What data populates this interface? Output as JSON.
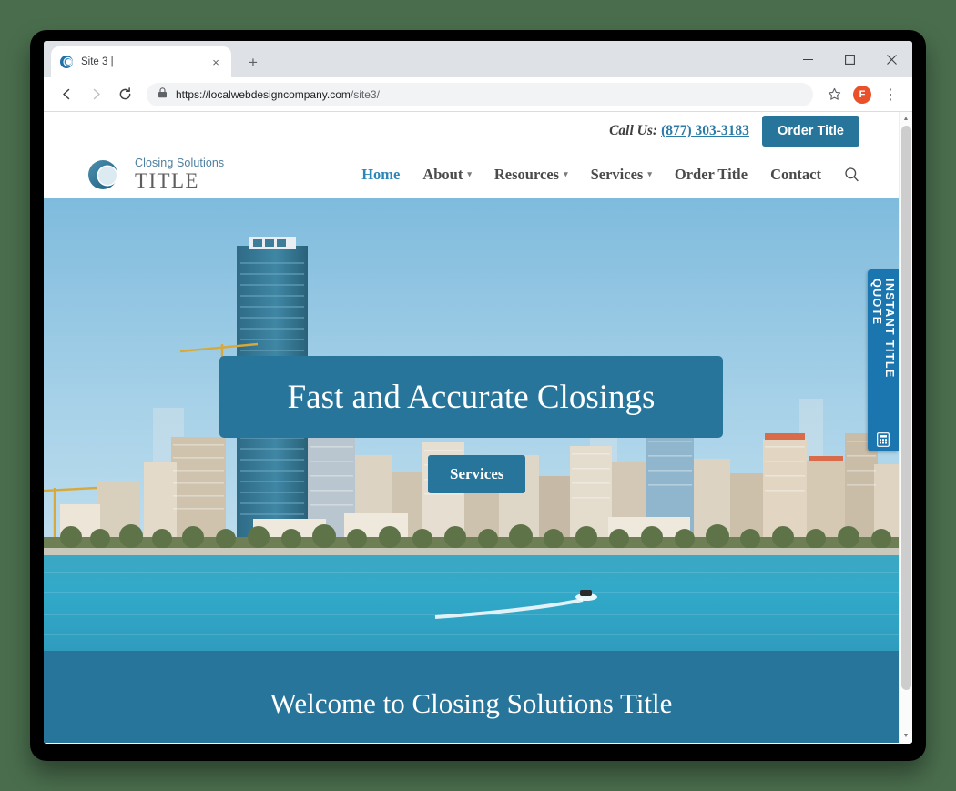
{
  "browser": {
    "tab": {
      "title": "Site 3 |",
      "favicon": "site-circle-icon",
      "close": "×"
    },
    "new_tab": "+",
    "window_controls": {
      "minimize": "–",
      "maximize": "□",
      "close": "×"
    },
    "toolbar": {
      "back": "←",
      "forward": "→",
      "reload": "⟳",
      "lock_icon": "lock-icon",
      "url_domain": "https://localwebdesigncompany.com",
      "url_path": "/site3/",
      "bookmark": "☆",
      "profile_initial": "F",
      "menu": "⋮"
    }
  },
  "site": {
    "topbar": {
      "call_label": "Call Us:",
      "phone": "(877) 303-3183",
      "order_button": "Order Title"
    },
    "logo": {
      "line1": "Closing Solutions",
      "line2": "TITLE",
      "mark": "circle-logo-icon"
    },
    "nav": [
      {
        "label": "Home",
        "caret": false,
        "active": true
      },
      {
        "label": "About",
        "caret": true,
        "active": false
      },
      {
        "label": "Resources",
        "caret": true,
        "active": false
      },
      {
        "label": "Services",
        "caret": true,
        "active": false
      },
      {
        "label": "Order Title",
        "caret": false,
        "active": false
      },
      {
        "label": "Contact",
        "caret": false,
        "active": false
      }
    ],
    "search_icon": "search-icon",
    "hero": {
      "headline": "Fast and Accurate Closings",
      "cta": "Services",
      "image_alt": "city-skyline-waterfront-photo"
    },
    "quote_tab": {
      "label": "INSTANT TITLE QUOTE",
      "icon": "calculator-icon"
    },
    "welcome": {
      "heading": "Welcome to Closing Solutions Title"
    }
  },
  "colors": {
    "brand_teal": "#27759b",
    "brand_link": "#2c7ba6",
    "nav_active": "#2c86b8",
    "quote_tab": "#1b76b0",
    "page_background": "#4a6e4d",
    "profile_avatar": "#e8512a"
  },
  "scrollbar": {
    "up": "▲",
    "down": "▼"
  }
}
